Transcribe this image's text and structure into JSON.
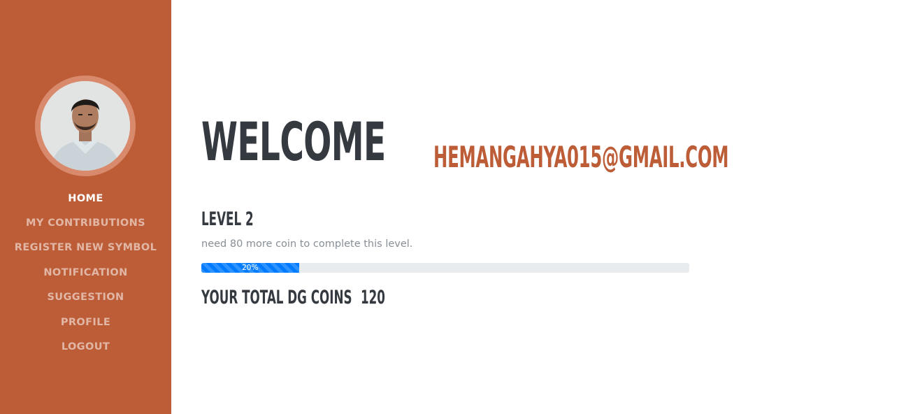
{
  "sidebar": {
    "avatar_alt": "profile photo",
    "nav": [
      {
        "label": "HOME",
        "active": true
      },
      {
        "label": "MY CONTRIBUTIONS",
        "active": false
      },
      {
        "label": "REGISTER NEW SYMBOL",
        "active": false
      },
      {
        "label": "NOTIFICATION",
        "active": false
      },
      {
        "label": "SUGGESTION",
        "active": false
      },
      {
        "label": "PROFILE",
        "active": false
      },
      {
        "label": "LOGOUT",
        "active": false
      }
    ]
  },
  "main": {
    "welcome": "WELCOME",
    "email": "HEMANGAHYA015@GMAIL.COM",
    "level_title": "LEVEL 2",
    "level_note": "need 80 more coin to complete this level.",
    "progress": {
      "percent": 20,
      "label": "20%"
    },
    "coins_label": "YOUR TOTAL DG COINS",
    "coins_value": "120"
  },
  "colors": {
    "sidebar": "#bd5d38",
    "accent": "#bd5d38",
    "heading": "#343a40",
    "progress": "#007bff"
  }
}
